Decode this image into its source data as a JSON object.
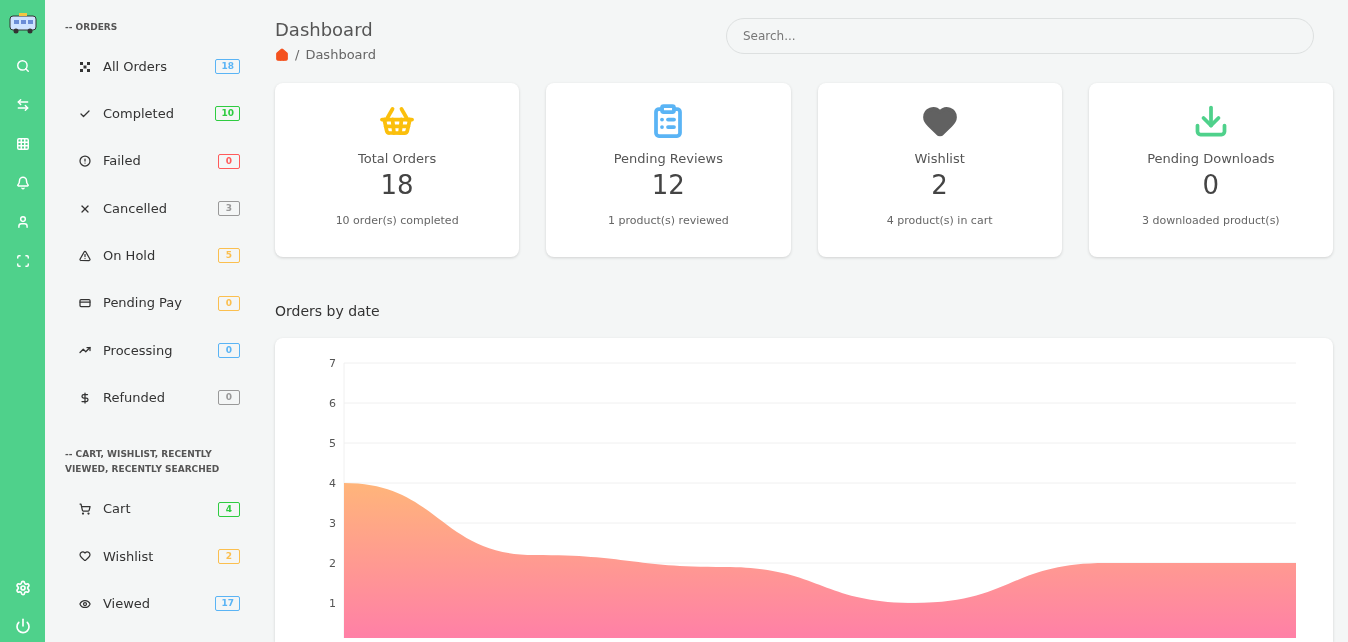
{
  "sidebar": {
    "sections": [
      {
        "heading": "-- ORDERS",
        "items": [
          {
            "label": "All Orders",
            "count": "18",
            "color": "#5ab4f5"
          },
          {
            "label": "Completed",
            "count": "10",
            "color": "#2ecc40"
          },
          {
            "label": "Failed",
            "count": "0",
            "color": "#ff5a5a"
          },
          {
            "label": "Cancelled",
            "count": "3",
            "color": "#999999"
          },
          {
            "label": "On Hold",
            "count": "5",
            "color": "#fbbf4f"
          },
          {
            "label": "Pending Pay",
            "count": "0",
            "color": "#fbbf4f"
          },
          {
            "label": "Processing",
            "count": "0",
            "color": "#5ab4f5"
          },
          {
            "label": "Refunded",
            "count": "0",
            "color": "#999999"
          }
        ]
      },
      {
        "heading": "-- CART, WISHLIST, RECENTLY VIEWED, RECENTLY SEARCHED",
        "items": [
          {
            "label": "Cart",
            "count": "4",
            "color": "#2ecc40"
          },
          {
            "label": "Wishlist",
            "count": "2",
            "color": "#fbbf4f"
          },
          {
            "label": "Viewed",
            "count": "17",
            "color": "#5ab4f5"
          }
        ]
      }
    ]
  },
  "header": {
    "title": "Dashboard",
    "breadcrumb": [
      {
        "separator": "/",
        "label": "Dashboard"
      }
    ],
    "search": {
      "placeholder": "Search..."
    }
  },
  "cards": [
    {
      "title": "Total Orders",
      "value": "18",
      "note": "10 order(s) completed",
      "color": "#fbbf0c"
    },
    {
      "title": "Pending Reviews",
      "value": "12",
      "note": "1 product(s) reviewed",
      "color": "#5ab4f5"
    },
    {
      "title": "Wishlist",
      "value": "2",
      "note": "4 product(s) in cart",
      "color": "#616161"
    },
    {
      "title": "Pending Downloads",
      "value": "0",
      "note": "3 downloaded product(s)",
      "color": "#4fd18b"
    }
  ],
  "chart": {
    "title": "Orders by date",
    "chart_data": {
      "type": "area",
      "values": [
        4,
        2.2,
        1.9,
        1.0,
        2.0,
        2.0
      ],
      "ylim": [
        0,
        7
      ],
      "grid": true,
      "yticks": [
        1,
        2,
        3,
        4,
        5,
        6,
        7
      ]
    }
  }
}
